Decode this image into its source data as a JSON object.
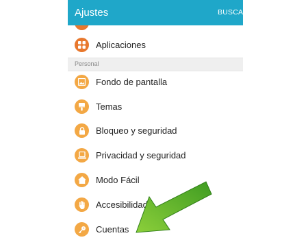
{
  "appbar": {
    "title": "Ajustes",
    "action": "BUSCAR",
    "color": "#1fa7c9"
  },
  "items_top": [
    {
      "label": "Aplicaciones",
      "icon": "grid-icon",
      "color": "#e8782d"
    }
  ],
  "section": {
    "label": "Personal"
  },
  "items": [
    {
      "label": "Fondo de pantalla",
      "icon": "wallpaper-icon",
      "color": "#f3a845"
    },
    {
      "label": "Temas",
      "icon": "brush-icon",
      "color": "#f3a845"
    },
    {
      "label": "Bloqueo y seguridad",
      "icon": "lock-icon",
      "color": "#f3a845"
    },
    {
      "label": "Privacidad y seguridad",
      "icon": "privacy-icon",
      "color": "#f3a845"
    },
    {
      "label": "Modo Fácil",
      "icon": "home-icon",
      "color": "#f3a845"
    },
    {
      "label": "Accesibilidad",
      "icon": "hand-icon",
      "color": "#f3a845"
    },
    {
      "label": "Cuentas",
      "icon": "key-icon",
      "color": "#f3a845"
    }
  ],
  "overlay": {
    "arrow_color": "#5cb82e"
  }
}
